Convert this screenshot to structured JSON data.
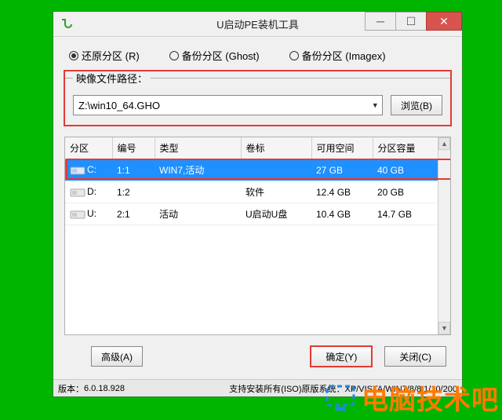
{
  "window": {
    "title": "U启动PE装机工具"
  },
  "radios": {
    "restore": "还原分区 (R)",
    "backup_ghost": "备份分区 (Ghost)",
    "backup_imagex": "备份分区 (Imagex)"
  },
  "path": {
    "legend": "映像文件路径：",
    "value": "Z:\\win10_64.GHO",
    "browse": "浏览(B)"
  },
  "table": {
    "headers": {
      "part": "分区",
      "index": "编号",
      "type": "类型",
      "label": "卷标",
      "free": "可用空间",
      "size": "分区容量"
    },
    "rows": [
      {
        "part": "C:",
        "index": "1:1",
        "type": "WIN7,活动",
        "label": "",
        "free": "27 GB",
        "size": "40 GB",
        "selected": true
      },
      {
        "part": "D:",
        "index": "1:2",
        "type": "",
        "label": "软件",
        "free": "12.4 GB",
        "size": "20 GB",
        "selected": false
      },
      {
        "part": "U:",
        "index": "2:1",
        "type": "活动",
        "label": "U启动U盘",
        "free": "10.4 GB",
        "size": "14.7 GB",
        "selected": false
      }
    ]
  },
  "buttons": {
    "advanced": "高级(A)",
    "ok": "确定(Y)",
    "close": "关闭(C)"
  },
  "status": {
    "version_label": "版本：",
    "version": "6.0.18.928",
    "support": "支持安装所有(ISO)原版系统：XP/VISTA/WIN7/8/8.1/10/200"
  },
  "watermark": "电脑技术吧"
}
